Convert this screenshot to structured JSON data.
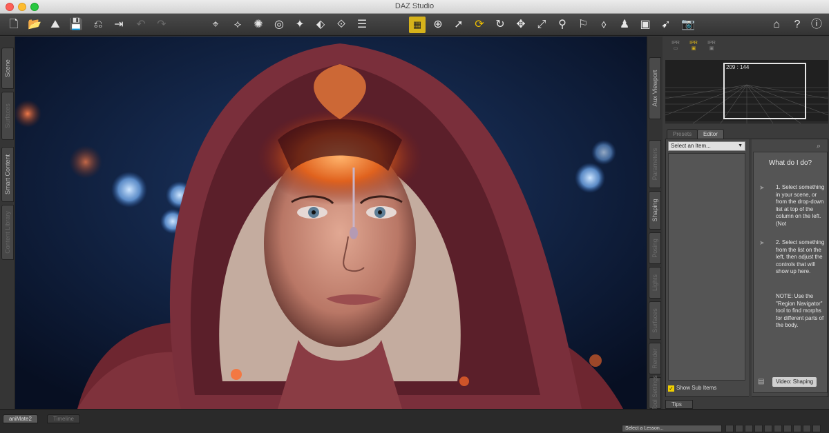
{
  "window": {
    "title": "DAZ Studio"
  },
  "toolbar": {
    "left_icons": [
      "new-file-icon",
      "open-file-icon",
      "open-folder-icon",
      "save-icon",
      "undo-history-icon",
      "export-icon",
      "undo-icon",
      "redo-icon"
    ],
    "center_icons": [
      "node-select-icon",
      "joint-editor-icon",
      "surface-selection-icon",
      "region-navigator-icon",
      "geometry-editor-icon",
      "transform-icon",
      "scene-navigator-icon",
      "menu-icon"
    ],
    "right_icons": [
      "render-active-icon",
      "camera-orbit-icon",
      "pointer-icon",
      "active-pose-icon",
      "rotate-icon",
      "translate-icon",
      "scale-icon",
      "figure-pose-icon",
      "universal-tool-icon",
      "paint-icon",
      "puppeteer-icon",
      "spot-render-icon",
      "node-pointer-icon",
      "render-camera-icon"
    ],
    "far_right_icons": [
      "home-icon",
      "help-icon",
      "info-icon"
    ],
    "active_color": "#d6b21a"
  },
  "left_panel": {
    "tabs": [
      "Scene",
      "Smart Content"
    ],
    "dim_tabs": [
      "Surfaces",
      "Content Library"
    ]
  },
  "right_panel": {
    "tabs": [
      "Aux Viewport",
      "Shaping"
    ],
    "dim_tabs": [
      "Parameters",
      "Posing",
      "Lights",
      "Surfaces",
      "Render",
      "Tool Settings"
    ],
    "aux_icons": [
      "IPR",
      "IPR",
      "IPR"
    ],
    "aux_readout": "209 : 144",
    "panel_tabs": {
      "presets": "Presets",
      "editor": "Editor"
    },
    "select_placeholder": "Select an Item...",
    "help_title": "What do I do?",
    "step1": "1. Select something in your scene, or from the drop-down list at top of the column on the left. (Not",
    "step2": "2. Select something from the list on the left, then adjust the controls that will show up here.",
    "note": "NOTE: Use the \"Region Navigator\" tool to find morphs for different parts of the body.",
    "show_sub_items": "Show Sub Items",
    "video_button": "Video: Shaping",
    "tips_tab": "Tips"
  },
  "bottom_bar": {
    "tabs": [
      "aniMate2",
      "Timeline"
    ],
    "lesson_select": "Select a Lesson..."
  }
}
